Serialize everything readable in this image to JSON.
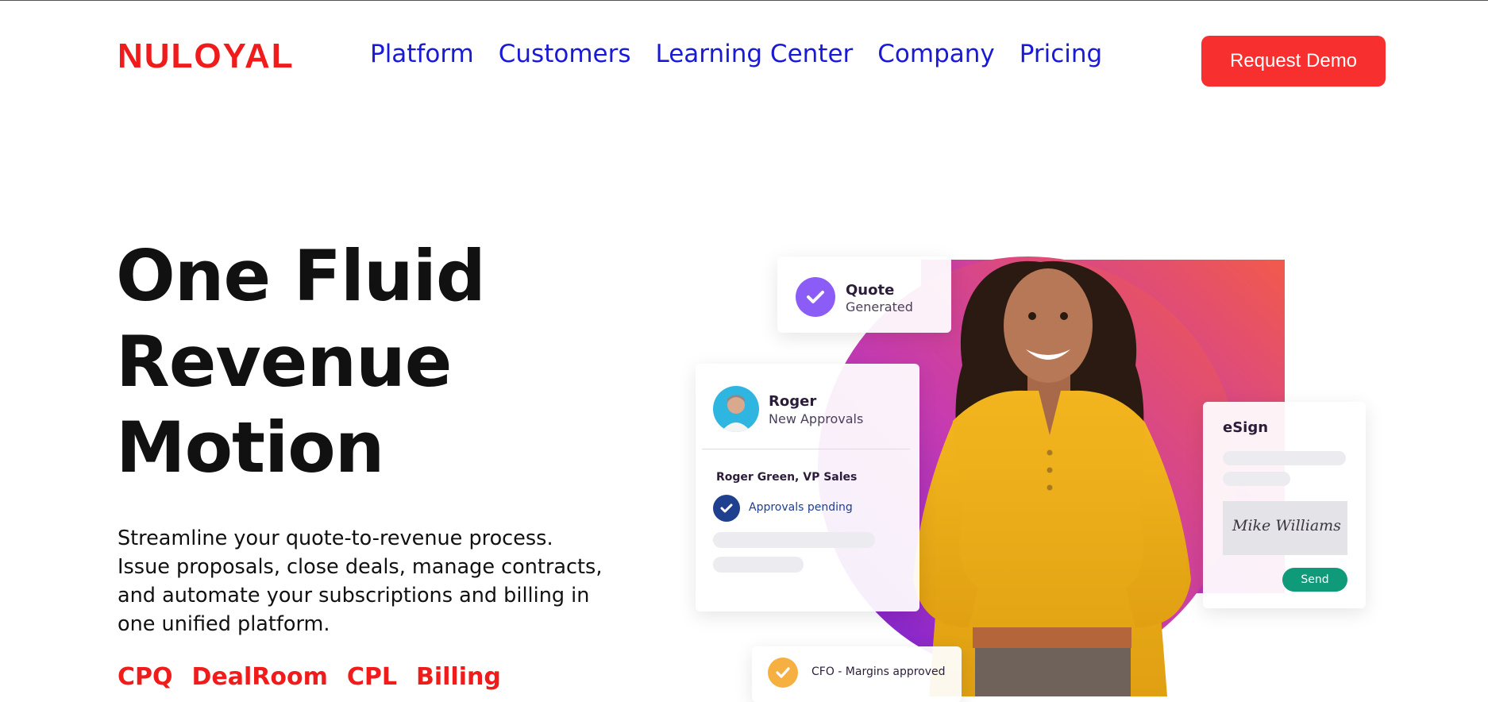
{
  "brand": {
    "name": "NULOYAL"
  },
  "nav": {
    "items": [
      {
        "label": "Platform"
      },
      {
        "label": "Customers"
      },
      {
        "label": "Learning Center"
      },
      {
        "label": "Company"
      },
      {
        "label": "Pricing"
      }
    ],
    "cta_label": "Request Demo"
  },
  "hero": {
    "headline_lines": [
      "One Fluid",
      "Revenue",
      "Motion"
    ],
    "description": "Streamline your quote-to-revenue process. Issue proposals, close deals, manage contracts, and automate your subscriptions and billing in one unified platform.",
    "products": [
      "CPQ",
      "DealRoom",
      "CPL",
      "Billing"
    ]
  },
  "illustration": {
    "quote_card": {
      "title": "Quote",
      "subtitle": "Generated"
    },
    "approval_card": {
      "name": "Roger",
      "subtitle": "New Approvals",
      "person": "Roger Green, VP Sales",
      "status": "Approvals pending"
    },
    "esign_card": {
      "title": "eSign",
      "signature": "Mike Williams",
      "button": "Send"
    },
    "cfo_card": {
      "text": "CFO - Margins approved"
    }
  },
  "colors": {
    "brand_red": "#f01c1c",
    "nav_blue": "#1a1ad6",
    "cta_red": "#f72f2f",
    "quote_purple": "#8b5cf6",
    "approval_navy": "#1f3f8f",
    "send_green": "#0f9a7a",
    "cfo_orange": "#f5b041"
  },
  "icons": {
    "quote": "check-circle-icon",
    "approval": "check-circle-icon",
    "cfo": "check-circle-icon",
    "avatar": "user-avatar"
  }
}
